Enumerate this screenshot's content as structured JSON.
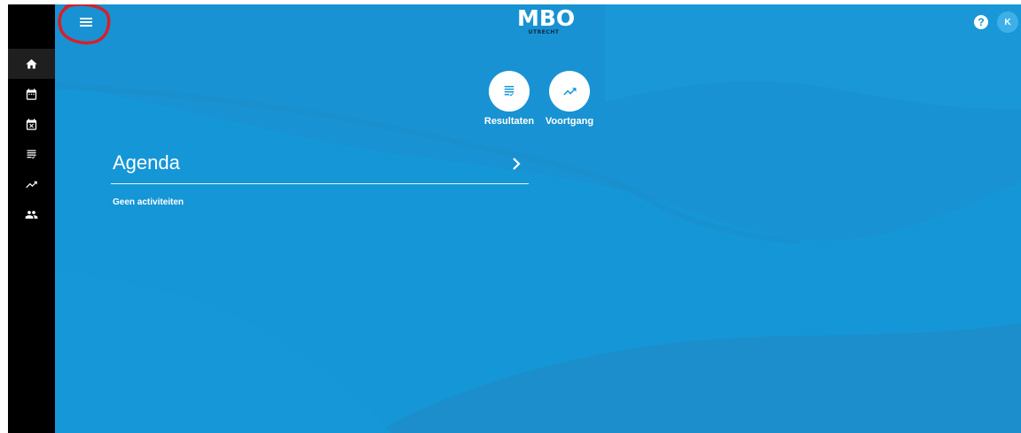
{
  "header": {
    "logo_text": "MBO",
    "logo_subtext": "UTRECHT",
    "help_label": "?",
    "avatar_initial": "K"
  },
  "sidebar": {
    "items": [
      {
        "icon": "home-icon",
        "active": true
      },
      {
        "icon": "calendar-icon",
        "active": false
      },
      {
        "icon": "calendar-cancel-icon",
        "active": false
      },
      {
        "icon": "results-list-icon",
        "active": false
      },
      {
        "icon": "trending-icon",
        "active": false
      },
      {
        "icon": "people-icon",
        "active": false
      }
    ]
  },
  "quick_links": [
    {
      "label": "Resultaten",
      "icon": "results-list-icon"
    },
    {
      "label": "Voortgang",
      "icon": "trending-icon"
    }
  ],
  "agenda": {
    "title": "Agenda",
    "empty_text": "Geen activiteiten"
  },
  "colors": {
    "background": "#1596d6",
    "sidebar": "#000000",
    "annotation": "#d6202a"
  }
}
